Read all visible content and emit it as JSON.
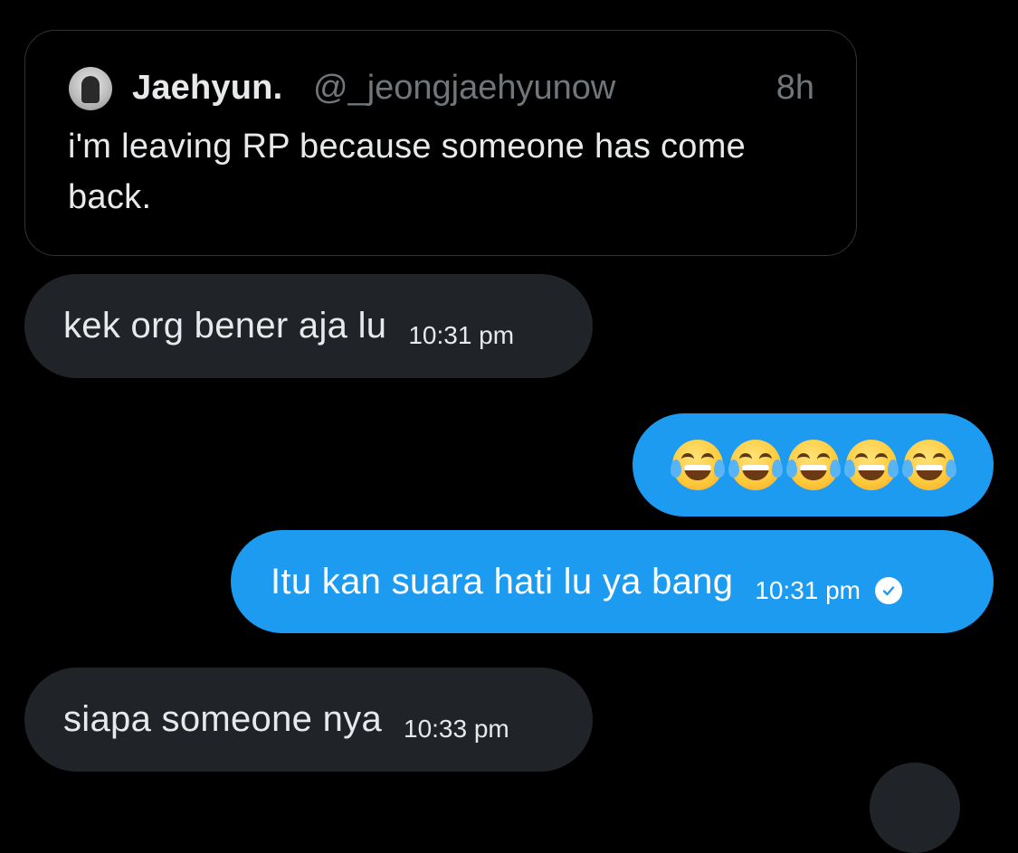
{
  "quoted_tweet": {
    "author_name": "Jaehyun.",
    "author_handle": "@_jeongjaehyunow",
    "time_ago": "8h",
    "text": "i'm leaving RP because someone has come back."
  },
  "messages": [
    {
      "direction": "incoming",
      "text": "kek org bener aja lu",
      "time": "10:31 pm"
    },
    {
      "direction": "outgoing",
      "emoji": "face-with-tears-of-joy",
      "emoji_count": 5
    },
    {
      "direction": "outgoing",
      "text": "Itu kan suara hati lu ya bang",
      "time": "10:31 pm",
      "status_icon": "read-check-icon"
    },
    {
      "direction": "incoming",
      "text": "siapa someone nya",
      "time": "10:33 pm"
    }
  ],
  "colors": {
    "background": "#000000",
    "incoming_bubble": "#202327",
    "outgoing_bubble": "#1d9bf0",
    "secondary_text": "#71767b"
  }
}
